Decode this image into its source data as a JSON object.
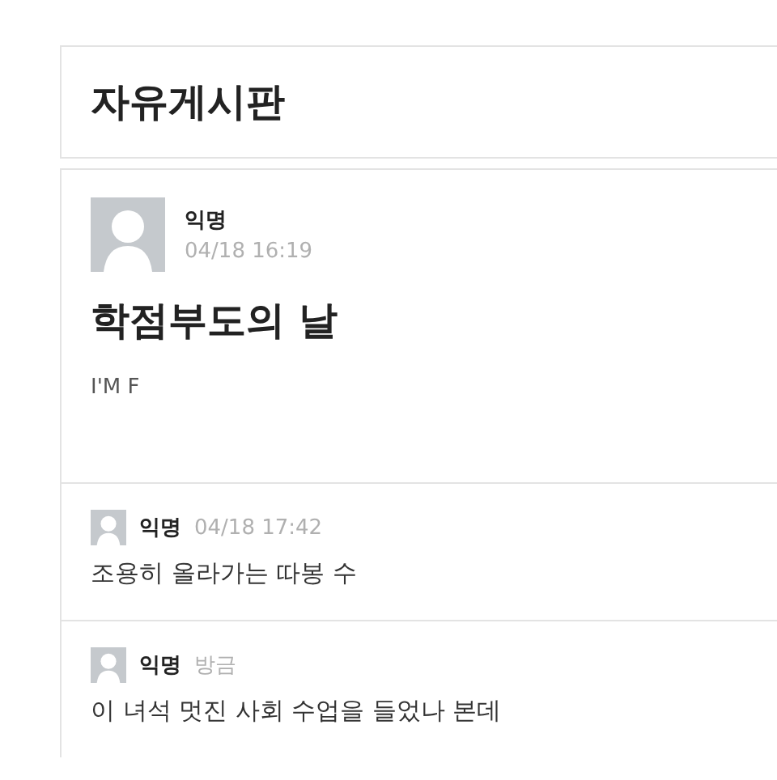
{
  "board": {
    "title": "자유게시판"
  },
  "post": {
    "author": "익명",
    "time": "04/18 16:19",
    "title": "학점부도의 날",
    "body": "I'M F"
  },
  "comments": [
    {
      "author": "익명",
      "time": "04/18 17:42",
      "text": "조용히 올라가는 따봉 수"
    },
    {
      "author": "익명",
      "time": "방금",
      "text": "이 녀석 멋진 사회 수업을 들었나 본데"
    }
  ]
}
